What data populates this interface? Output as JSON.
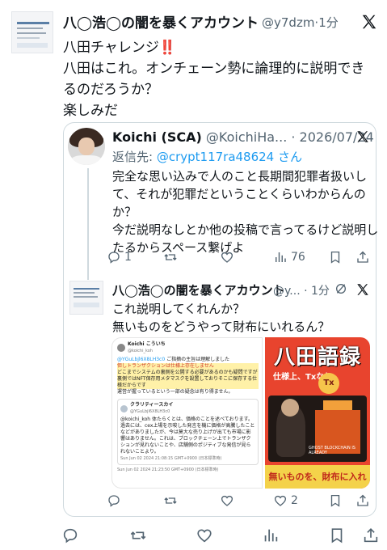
{
  "main_tweet": {
    "author_name": "八◯浩◯の闇を暴くアカウント",
    "handle_time": "@y7dzm·1分",
    "lines": [
      "八田チャレンジ‼️",
      "八田はこれ。オンチェーン勢に論理的に説明でき",
      "るのだろうか？",
      "楽しみだ"
    ],
    "actions": {
      "reply": "",
      "retweet": "",
      "like": "",
      "views": "",
      "bookmark": "",
      "share": ""
    }
  },
  "quoted_tweet": {
    "author_name": "Koichi (SCA)",
    "handle_date": "@KoichiHa... · 2026/07/24",
    "reply_prefix": "返信先: ",
    "reply_to": "@crypt117ra48624 さん",
    "lines": [
      "完全な思い込みで人のこと長期間犯罪者扱いし",
      "て、それが犯罪だということくらいわからんの",
      "か？",
      "今だ説明なしとか他の投稿で言ってるけど説明し",
      "たるからスペース繋げよ"
    ],
    "actions": {
      "reply": "1",
      "retweet": "",
      "like": "",
      "views": "76"
    }
  },
  "nested_tweet": {
    "author_name": "八◯浩◯の闇を暴くアカウント",
    "handle_time": "@y... · 1分",
    "lines": [
      "これ説明してくれんか？",
      "無いものをどうやって財布にいれるん？"
    ],
    "actions": {
      "reply": "",
      "retweet": "",
      "like": "2",
      "views": ""
    },
    "media_left": {
      "author": "Koichi こういち",
      "handle": "@koichi_koh",
      "mention": "@YGuLbjl6X8LH3c0",
      "p1": "ご指摘の主旨は理解しました",
      "p2": "但しトランザクションは仕様上存在しません",
      "p3": "どこまでシステムの裏側を公開する必要があるのかも疑問ですが裏側ではNFT保存用メタマスクを設置しておりそこに保存する仕様だからです",
      "p4": "運営が握っているという一部の疑念は有り得ません。",
      "sub_name": "クラリティースカイ",
      "sub_handle": "@YGuLbjl6X8LH3c0",
      "sub_body": "@koichi_koh 体たらくとは、価格のことを述べております。過去には、cex上場を示唆した発言を機に価格が高騰したことなどがありましたが、今は莫大な売り上げが出ても市場に影響はありません。これは、ブロックチェーン上でトランザクションが見れないことや、店舗側のポジティブな発信が見られないことより。",
      "timestamp1": "Sun Jun 02 2024 21:08:15 GMT+0900 (日本標準時)",
      "timestamp2": "Sun Jun 02 2024 21:23:50 GMT+0900 (日本標準時)"
    },
    "media_right": {
      "title": "八田語録",
      "subtitle": "仕様上、Txなし",
      "badge": "Tx",
      "caption": "GHOST BLOCKCHAIN IS ALREADY",
      "banner": "無いものを、財布に入れる天才"
    }
  }
}
